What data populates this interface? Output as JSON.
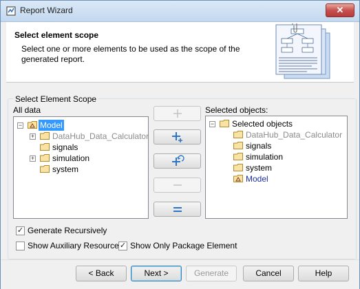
{
  "window": {
    "title": "Report Wizard",
    "close_glyph": "✕"
  },
  "header": {
    "title": "Select element scope",
    "description": "Select one or more elements to be used as the scope of the generated report.",
    "art_icon": "report-document-icon"
  },
  "scope_group": {
    "label": "Select Element Scope"
  },
  "all_data": {
    "label": "All data",
    "nodes": [
      {
        "label": "Model",
        "selected": true
      },
      {
        "label": "DataHub_Data_Calculator"
      },
      {
        "label": "signals"
      },
      {
        "label": "simulation"
      },
      {
        "label": "system"
      }
    ]
  },
  "selected_objects": {
    "label": "Selected objects:",
    "root": "Selected objects",
    "nodes": [
      {
        "label": "DataHub_Data_Calculator"
      },
      {
        "label": "signals"
      },
      {
        "label": "simulation"
      },
      {
        "label": "system"
      },
      {
        "label": "Model"
      }
    ]
  },
  "middle_buttons": [
    {
      "name": "add-button",
      "glyph": "+",
      "enabled": false
    },
    {
      "name": "add-all-button",
      "glyph": "+",
      "enabled": true
    },
    {
      "name": "add-recursive-button",
      "glyph": "+",
      "enabled": true
    },
    {
      "name": "remove-button",
      "glyph": "−",
      "enabled": false
    },
    {
      "name": "remove-all-button",
      "glyph": "=",
      "enabled": true
    }
  ],
  "options": {
    "generate_recursively": {
      "label": "Generate Recursively",
      "checked": true
    },
    "show_auxiliary": {
      "label": "Show Auxiliary Resources",
      "checked": false
    },
    "show_only_package": {
      "label": "Show Only Package Element",
      "checked": true
    }
  },
  "footer": {
    "back": "< Back",
    "next": "Next >",
    "generate": "Generate",
    "cancel": "Cancel",
    "help": "Help"
  },
  "colors": {
    "accent": "#3399ff",
    "model_blue": "#1b2fa0",
    "disabled_text": "#8a8a8a"
  }
}
